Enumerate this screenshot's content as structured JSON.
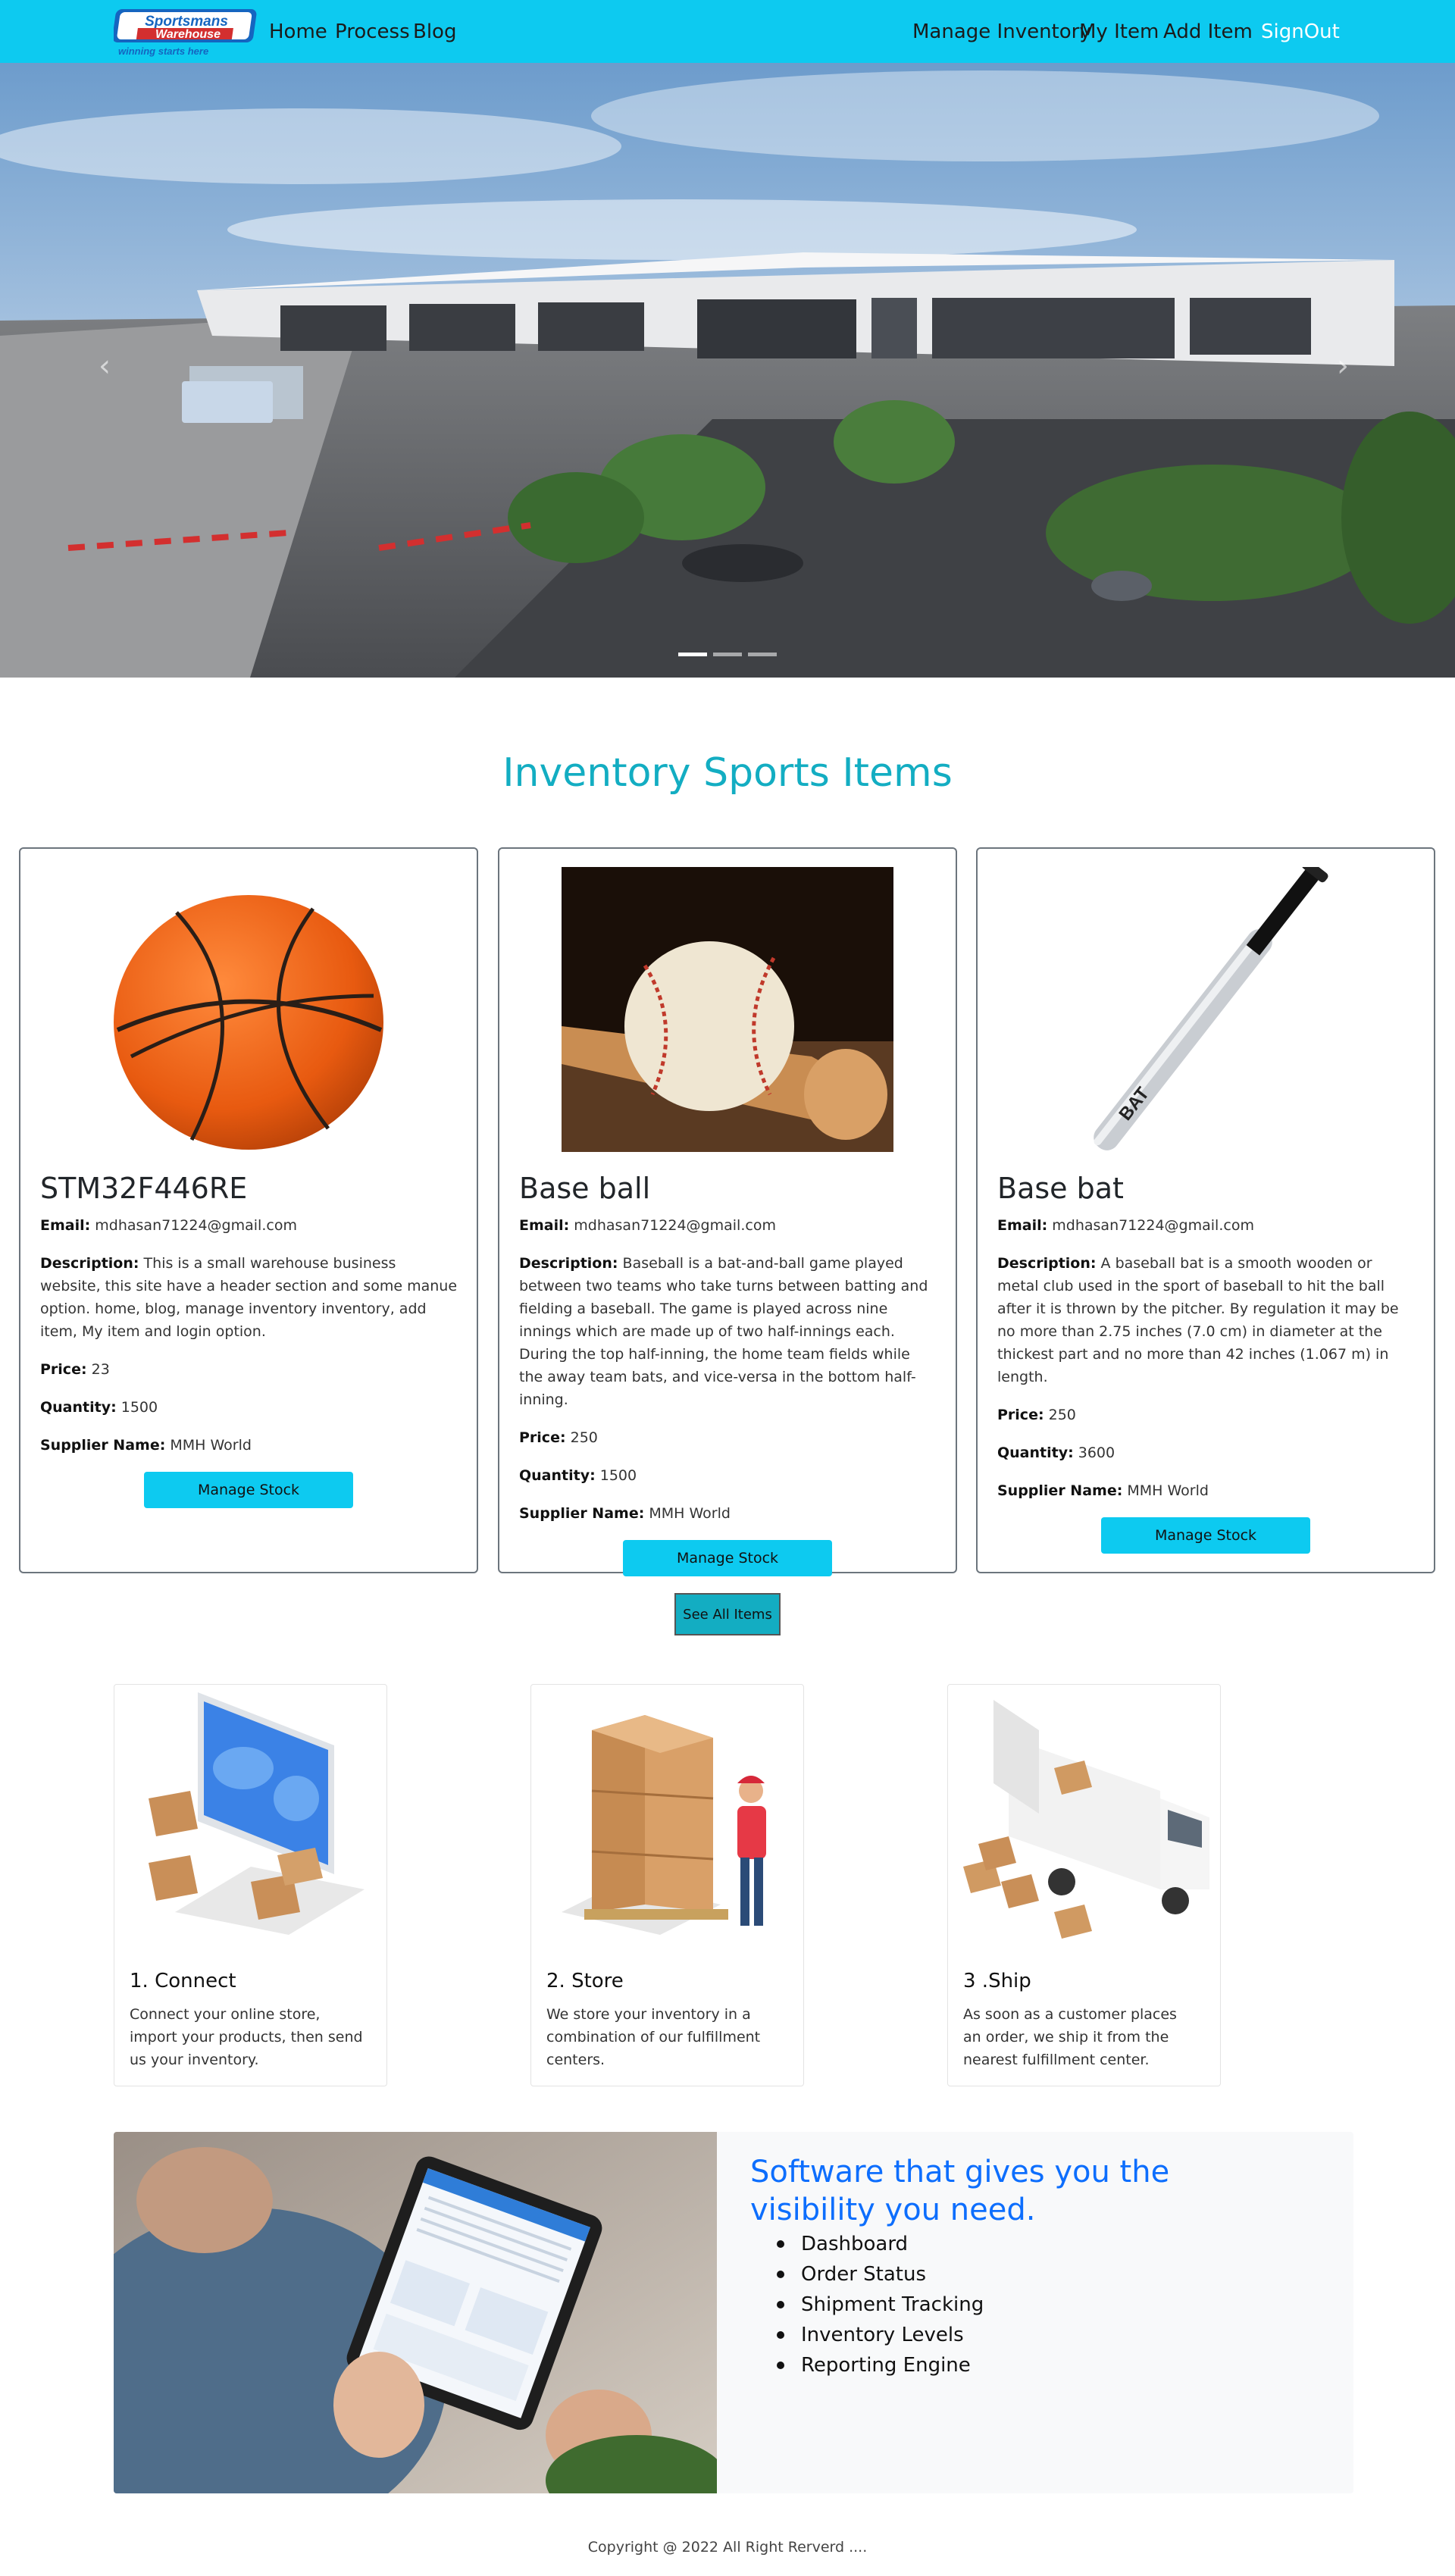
{
  "nav": {
    "logo_line1": "Sportsmans",
    "logo_line2": "Warehouse",
    "logo_tagline": "winning starts here",
    "left_links": [
      "Home",
      "Process",
      "Blog"
    ],
    "right_links": [
      "Manage Inventory",
      "My Item",
      "Add Item",
      "SignOut"
    ]
  },
  "hero": {
    "slides": 3,
    "active_slide": 1
  },
  "section": {
    "title": "Inventory Sports Items"
  },
  "labels": {
    "email": "Email:",
    "description": "Description:",
    "price": "Price:",
    "quantity": "Quantity:",
    "supplier": "Supplier Name:"
  },
  "items": [
    {
      "name": "STM32F446RE",
      "email": "mdhasan71224@gmail.com",
      "description": "This is a small warehouse business website, this site have a header section and some manue option. home, blog, manage inventory inventory, add item, My item and login option.",
      "price": "23",
      "quantity": "1500",
      "supplier": "MMH World",
      "button": "Manage Stock"
    },
    {
      "name": "Base ball",
      "email": "mdhasan71224@gmail.com",
      "description": "Baseball is a bat-and-ball game played between two teams who take turns between batting and fielding a baseball. The game is played across nine innings which are made up of two half-innings each. During the top half-inning, the home team fields while the away team bats, and vice-versa in the bottom half-inning.",
      "price": "250",
      "quantity": "1500",
      "supplier": "MMH World",
      "button": "Manage Stock"
    },
    {
      "name": "Base bat",
      "email": "mdhasan71224@gmail.com",
      "description": "A baseball bat is a smooth wooden or metal club used in the sport of baseball to hit the ball after it is thrown by the pitcher. By regulation it may be no more than 2.75 inches (7.0 cm) in diameter at the thickest part and no more than 42 inches (1.067 m) in length.",
      "price": "250",
      "quantity": "3600",
      "supplier": "MMH World",
      "button": "Manage Stock",
      "image_text": "BAT"
    }
  ],
  "see_all": "See All Items",
  "steps": [
    {
      "title": "1. Connect",
      "text": "Connect your online store, import your products, then send us your inventory."
    },
    {
      "title": "2. Store",
      "text": "We store your inventory in a combination of our fulfillment centers."
    },
    {
      "title": "3 .Ship",
      "text": "As soon as a customer places an order, we ship it from the nearest fulfillment center."
    }
  ],
  "software": {
    "title": "Software that gives you the visibility you need.",
    "features": [
      "Dashboard",
      "Order Status",
      "Shipment Tracking",
      "Inventory Levels",
      "Reporting Engine"
    ]
  },
  "footer": "Copyright @ 2022 All Right Rerverd ...."
}
